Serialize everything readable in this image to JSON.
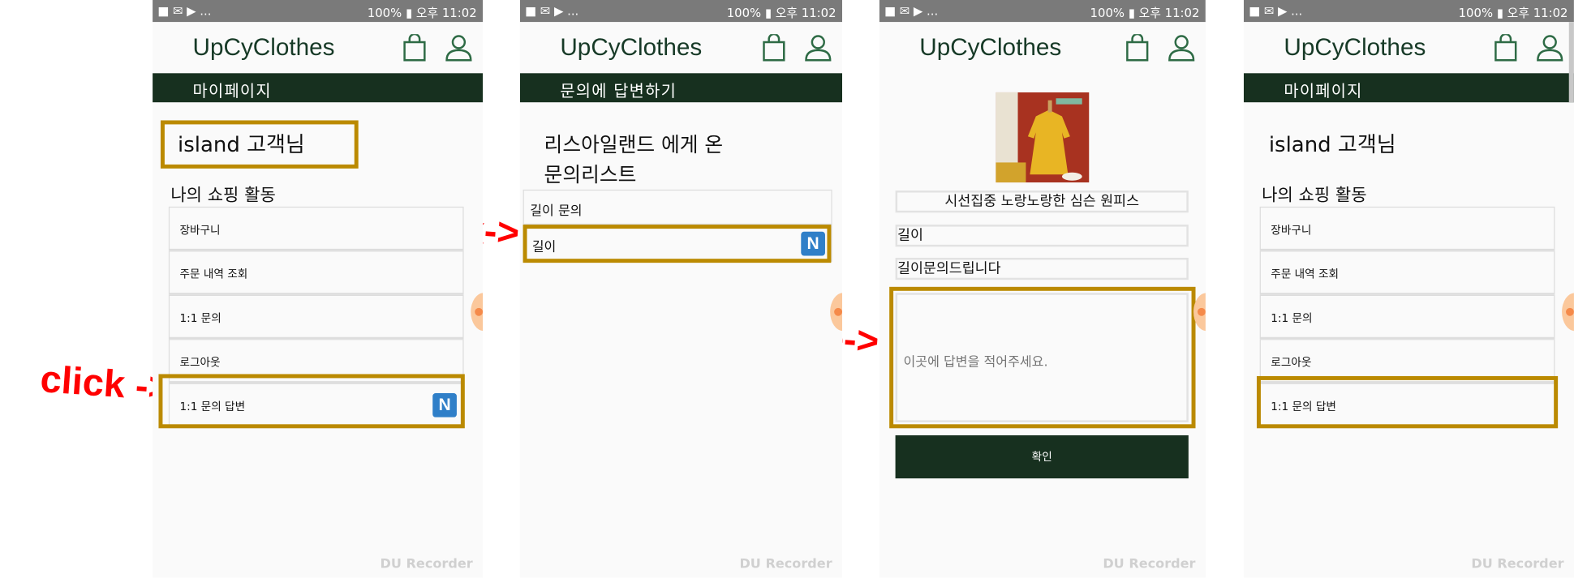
{
  "status": {
    "left": "■ ✉ ▶ ...",
    "right": "100% ▮ 오후 11:02"
  },
  "app": {
    "logo": "UpCyClothes"
  },
  "annotations": {
    "click1": "click ->",
    "click2": "click->",
    "write": "write->"
  },
  "panel1": {
    "bar_title": "마이페이지",
    "greeting": "island 고객님",
    "section": "나의 쇼핑 활동",
    "items": [
      "장바구니",
      "주문 내역 조회",
      "1:1 문의",
      "로그아웃",
      "1:1 문의 답변"
    ],
    "badge": "N"
  },
  "panel2": {
    "bar_title": "문의에 답변하기",
    "heading1": "리스아일랜드 에게 온",
    "heading2": "문의리스트",
    "items": [
      "길이 문의",
      "길이"
    ],
    "badge": "N"
  },
  "panel3": {
    "product_title": "시선집중 노랑노랑한 심슨 원피스",
    "inquiry_title": "길이",
    "inquiry_body": "길이문의드립니다",
    "answer_placeholder": "이곳에 답변을 적어주세요.",
    "confirm": "확인"
  },
  "panel4": {
    "bar_title": "마이페이지",
    "greeting": "island 고객님",
    "section": "나의 쇼핑 활동",
    "items": [
      "장바구니",
      "주문 내역 조회",
      "1:1 문의",
      "로그아웃",
      "1:1 문의 답변"
    ]
  },
  "watermark": "DU Recorder",
  "colors": {
    "header_bar": "#17301f",
    "highlight": "#bb8a00",
    "annotation": "#ff0000",
    "badge": "#2f7fc8"
  }
}
